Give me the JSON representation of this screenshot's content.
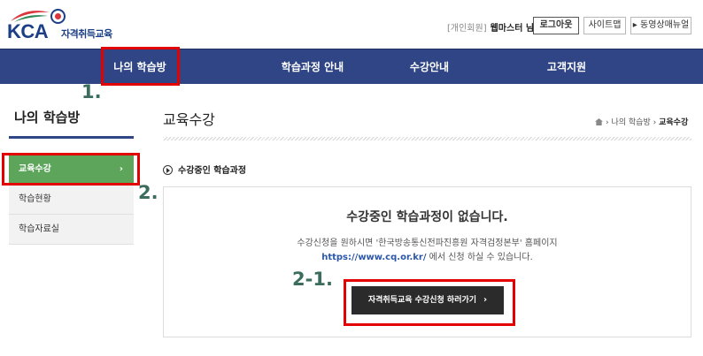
{
  "header": {
    "logo_text": "KCA",
    "logo_sub": "자격취득교육",
    "member_type": "[개인회원]",
    "user_name": "웹마스터 님",
    "logout_label": "로그아웃",
    "sitemap_label": "사이트맵",
    "manual_label": "▸ 동영상매뉴얼"
  },
  "nav": {
    "items": [
      {
        "label": "나의 학습방"
      },
      {
        "label": "학습과정 안내"
      },
      {
        "label": "수강안내"
      },
      {
        "label": "고객지원"
      }
    ]
  },
  "annotations": {
    "a1": "1.",
    "a2": "2.",
    "a3": "2-1."
  },
  "sidebar": {
    "title": "나의 학습방",
    "items": [
      {
        "label": "교육수강",
        "arrow": "›"
      },
      {
        "label": "학습현황"
      },
      {
        "label": "학습자료실"
      }
    ]
  },
  "main": {
    "title": "교육수강",
    "breadcrumb": {
      "b1": "나의 학습방",
      "sep": "›",
      "b2": "교육수강"
    },
    "section_heading": "수강중인 학습과정",
    "empty_title": "수강중인 학습과정이 없습니다.",
    "line1": "수강신청을 원하시면 '한국방송통신전파진흥원 자격검정본부' 홈페이지",
    "link": "https://www.cq.or.kr/",
    "line2_rest": " 에서 신청 하실 수 있습니다.",
    "cta_label": "자격취득교육 수강신청 하러가기",
    "cta_chev": "›"
  },
  "colors": {
    "nav_bg": "#2f4585",
    "active_green": "#5ca55a",
    "annotation_red": "#e30000",
    "annotation_text": "#3c6c5d"
  }
}
